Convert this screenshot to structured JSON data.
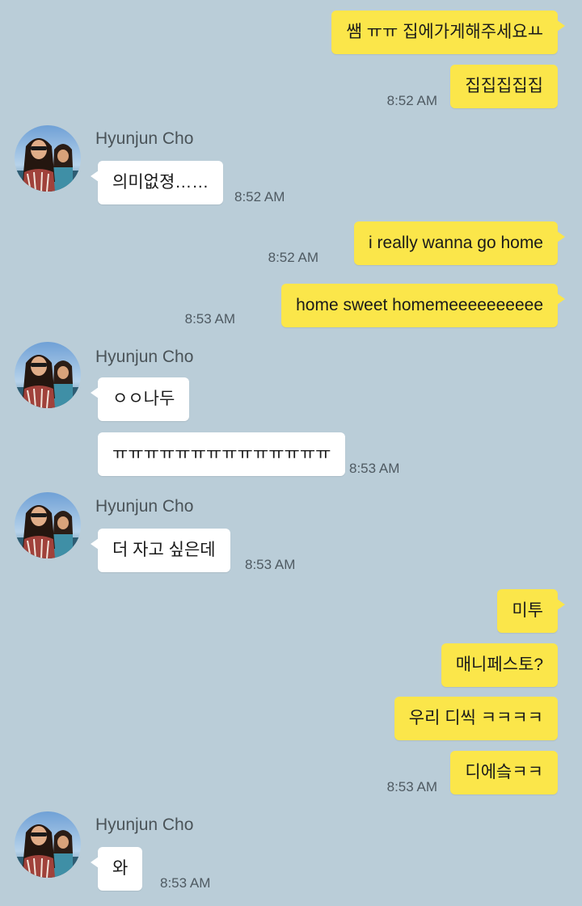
{
  "contact_name": "Hyunjun Cho",
  "messages": {
    "m1": "쌤 ㅠㅠ 집에가게해주세요ㅛ",
    "m2": "집집집집집",
    "t1": "8:52 AM",
    "m3": "의미없졍……",
    "t2": "8:52 AM",
    "m4": "i really wanna go home",
    "t3": "8:52 AM",
    "m5": "home sweet homemeeeeeeeeee",
    "t4": "8:53 AM",
    "m6": "ㅇㅇ나두",
    "m7": "ㅠㅠㅠㅠㅠㅠㅠㅠㅠㅠㅠㅠㅠㅠ",
    "t5": "8:53 AM",
    "m8": "더 자고 싶은데",
    "t6": "8:53 AM",
    "m9": "미투",
    "m10": "매니페스토?",
    "m11": "우리 디씩 ㅋㅋㅋㅋ",
    "m12": "디에슼ㅋㅋ",
    "t7": "8:53 AM",
    "m13": "와",
    "t8": "8:53 AM"
  },
  "colors": {
    "background": "#bacdd8",
    "my_bubble": "#fbe64a",
    "their_bubble": "#ffffff"
  },
  "icons": {
    "avatar": "profile-photo"
  }
}
